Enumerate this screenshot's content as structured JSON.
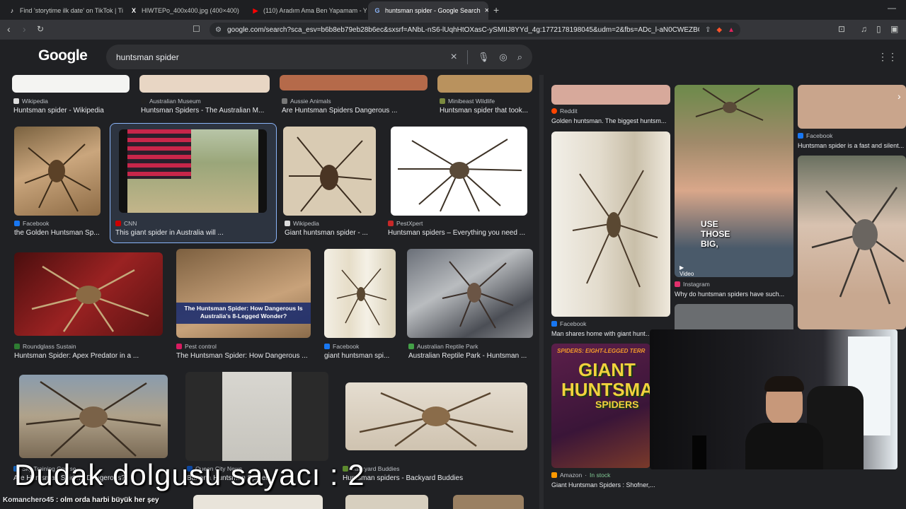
{
  "tabs": [
    {
      "label": "Find 'storytime ilk date' on TikTok | Ti",
      "icon": "tiktok-icon"
    },
    {
      "label": "HIWTEPo_400x400.jpg (400×400)",
      "icon": "x-icon"
    },
    {
      "label": "(110) Aradım Ama Ben Yapamam - Yo",
      "icon": "youtube-icon"
    },
    {
      "label": "huntsman spider - Google Search",
      "icon": "google-icon"
    }
  ],
  "url": "google.com/search?sca_esv=b6b8eb79eb28b6ec&sxsrf=ANbL-nS6-lUqhHtOXasC-ySMIIJ8YYd_4g:1772178198045&udm=2&fbs=ADc_l-aN0CWEZBO...",
  "google": {
    "logo": "Google"
  },
  "search": {
    "query": "huntsman spider"
  },
  "top_row": [
    {
      "source": "Wikipedia",
      "title": "Huntsman spider - Wikipedia"
    },
    {
      "source": "Australian Museum",
      "title": "Huntsman Spiders - The Australian M..."
    },
    {
      "source": "Aussie Animals",
      "title": "Are Huntsman Spiders Dangerous ..."
    },
    {
      "source": "Minibeast Wildlife",
      "title": "Huntsman spider that took..."
    }
  ],
  "row2": [
    {
      "source": "Facebook",
      "title": "the Golden Huntsman Sp..."
    },
    {
      "source": "CNN",
      "title": "This giant spider in Australia will ..."
    },
    {
      "source": "Wikipedia",
      "title": "Giant huntsman spider - ..."
    },
    {
      "source": "PestXpert",
      "title": "Huntsman spiders – Everything you need ..."
    }
  ],
  "row3": [
    {
      "source": "Roundglass Sustain",
      "title": "Huntsman Spider: Apex Predator in a ..."
    },
    {
      "source": "Pest control",
      "title": "The Huntsman Spider: How Dangerous ...",
      "overlay": "The Huntsman Spider: How Dangerous Is Australia's 8-Legged Wonder?"
    },
    {
      "source": "Facebook",
      "title": "giant huntsman spi..."
    },
    {
      "source": "Australian Reptile Park",
      "title": "Australian Reptile Park - Huntsman ..."
    }
  ],
  "row4": [
    {
      "source": "Sky Training Course",
      "title": "Are Huntsman Spiders Dangerous?"
    },
    {
      "source": "Queen City News",
      "title": "Banana Huntsman Spider..."
    },
    {
      "source": "Backyard Buddies",
      "title": "Huntsman spiders - Backyard Buddies"
    }
  ],
  "right_panel": {
    "col1": [
      {
        "source": "Reddit",
        "title": "Golden huntsman. The biggest huntsm..."
      },
      {
        "source": "Facebook",
        "title": "Man shares home with giant huntsm..."
      },
      {
        "source": "Amazon",
        "stock": "In stock",
        "title": "Giant Huntsman Spiders : Shofner,...",
        "poster_line1": "GIANT",
        "poster_line2": "HUNTSMA",
        "poster_line3": "SPIDERS",
        "poster_top": "SPIDERS: EIGHT-LEGGED TERR"
      }
    ],
    "col2": [
      {
        "source": "Instagram",
        "title": "Why do huntsman spiders have such...",
        "caption": "USE THOSE BIG,",
        "badge": "Video"
      }
    ],
    "col3": [
      {
        "source": "Facebook",
        "title": "Huntsman spider is a fast and silent..."
      }
    ]
  },
  "overlay": {
    "text": "Dudak dolgusu  sayacı : 2"
  },
  "chat": {
    "user": "Komanchero45",
    "message": ": olm orda harbi büyük her şey"
  },
  "colors": {
    "background": "#202124",
    "accent": "#8ab4f8",
    "reddit": "#ff4500",
    "facebook": "#1877f2",
    "instagram": "#e1306c",
    "instock": "#81c995"
  }
}
